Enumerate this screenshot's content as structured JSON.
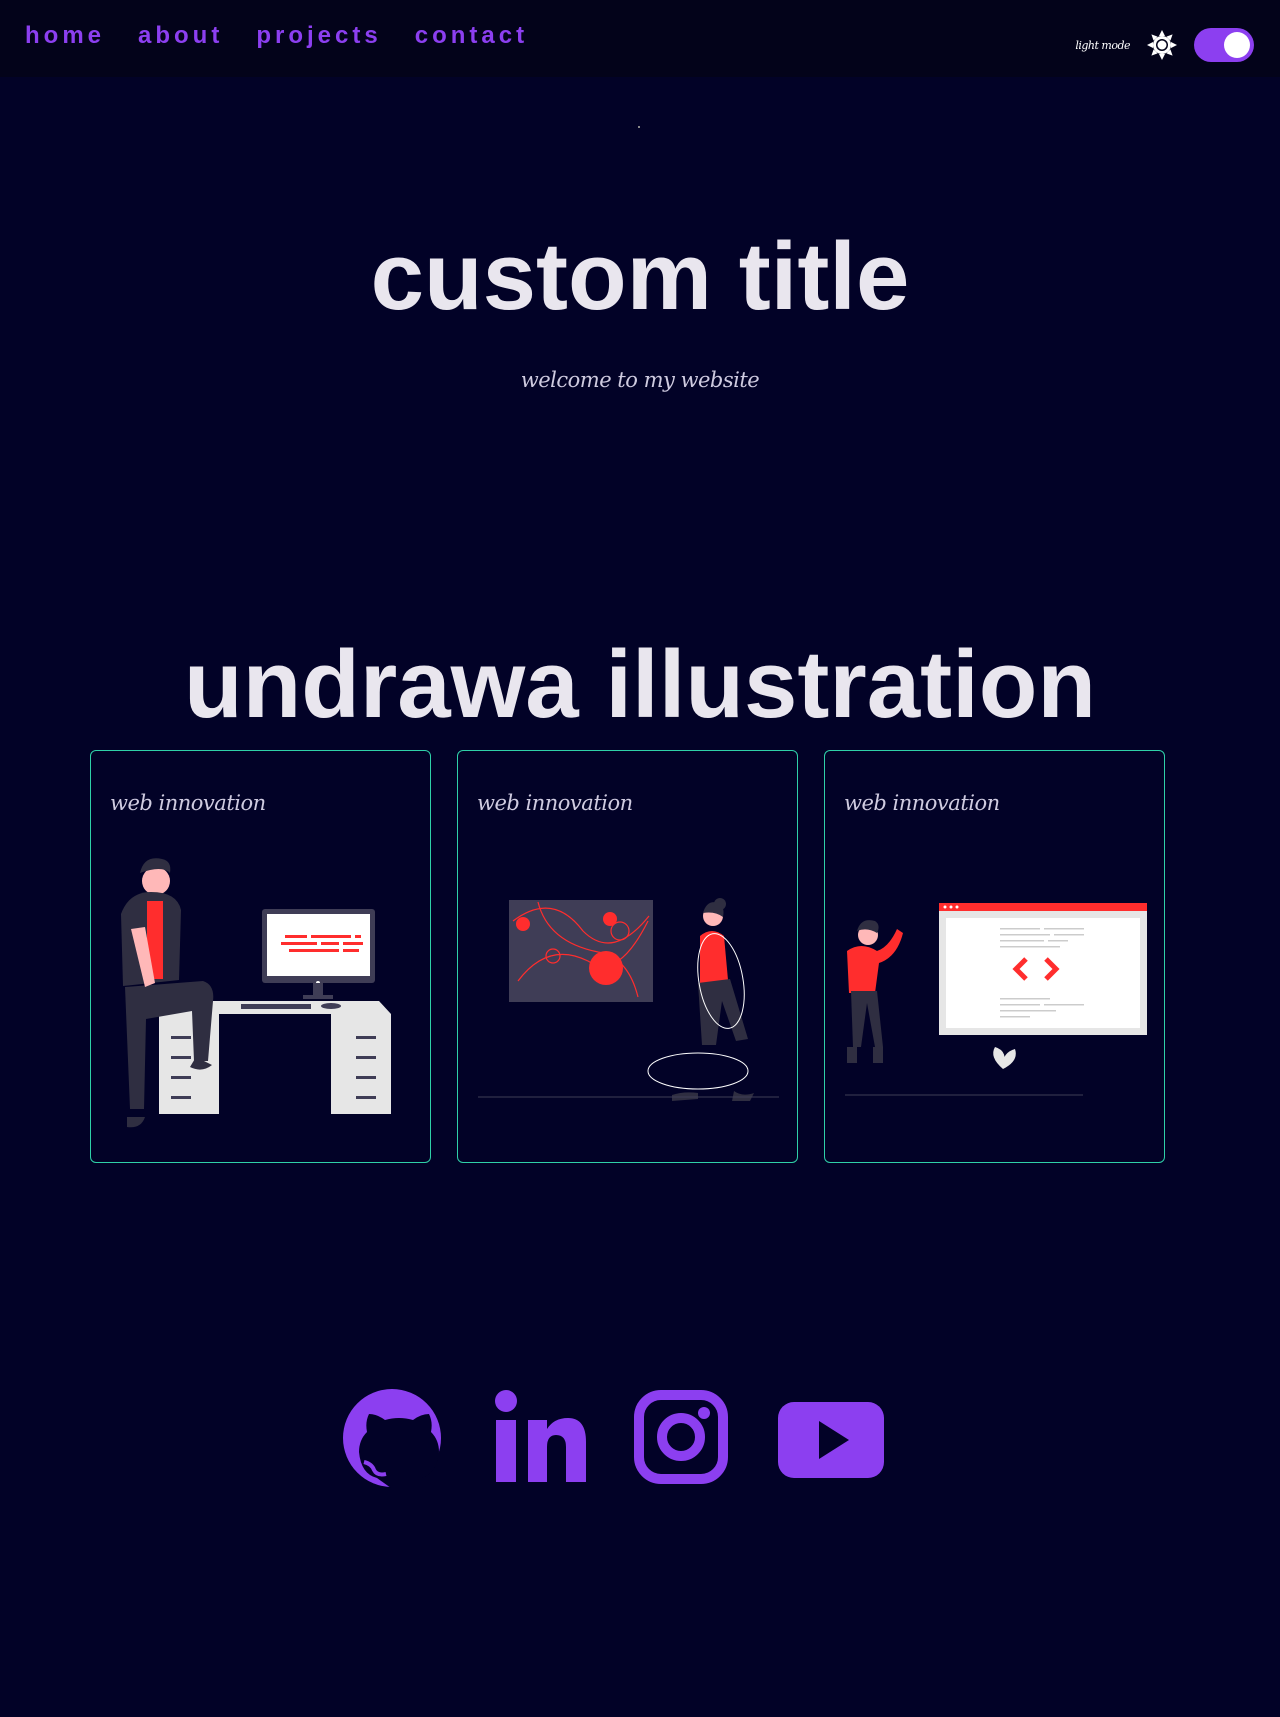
{
  "nav": {
    "items": [
      {
        "label": "home"
      },
      {
        "label": "about"
      },
      {
        "label": "projects"
      },
      {
        "label": "contact"
      }
    ]
  },
  "theme": {
    "mode_label": "light mode",
    "toggle_on": true,
    "accent": "#8c3ff0",
    "background": "#020227",
    "card_border": "#2fd0a8",
    "illustration_accent": "#ff2d2d"
  },
  "hero": {
    "title": "custom title",
    "subtitle": "welcome to my website"
  },
  "illustrations": {
    "title": "undrawa illustration",
    "cards": [
      {
        "title": "web innovation",
        "icon": "person-at-desk-illustration"
      },
      {
        "title": "web innovation",
        "icon": "woman-walking-illustration"
      },
      {
        "title": "web innovation",
        "icon": "woman-with-browser-illustration"
      }
    ]
  },
  "socials": [
    {
      "icon": "github-icon"
    },
    {
      "icon": "linkedin-icon"
    },
    {
      "icon": "instagram-icon"
    },
    {
      "icon": "youtube-icon"
    }
  ]
}
